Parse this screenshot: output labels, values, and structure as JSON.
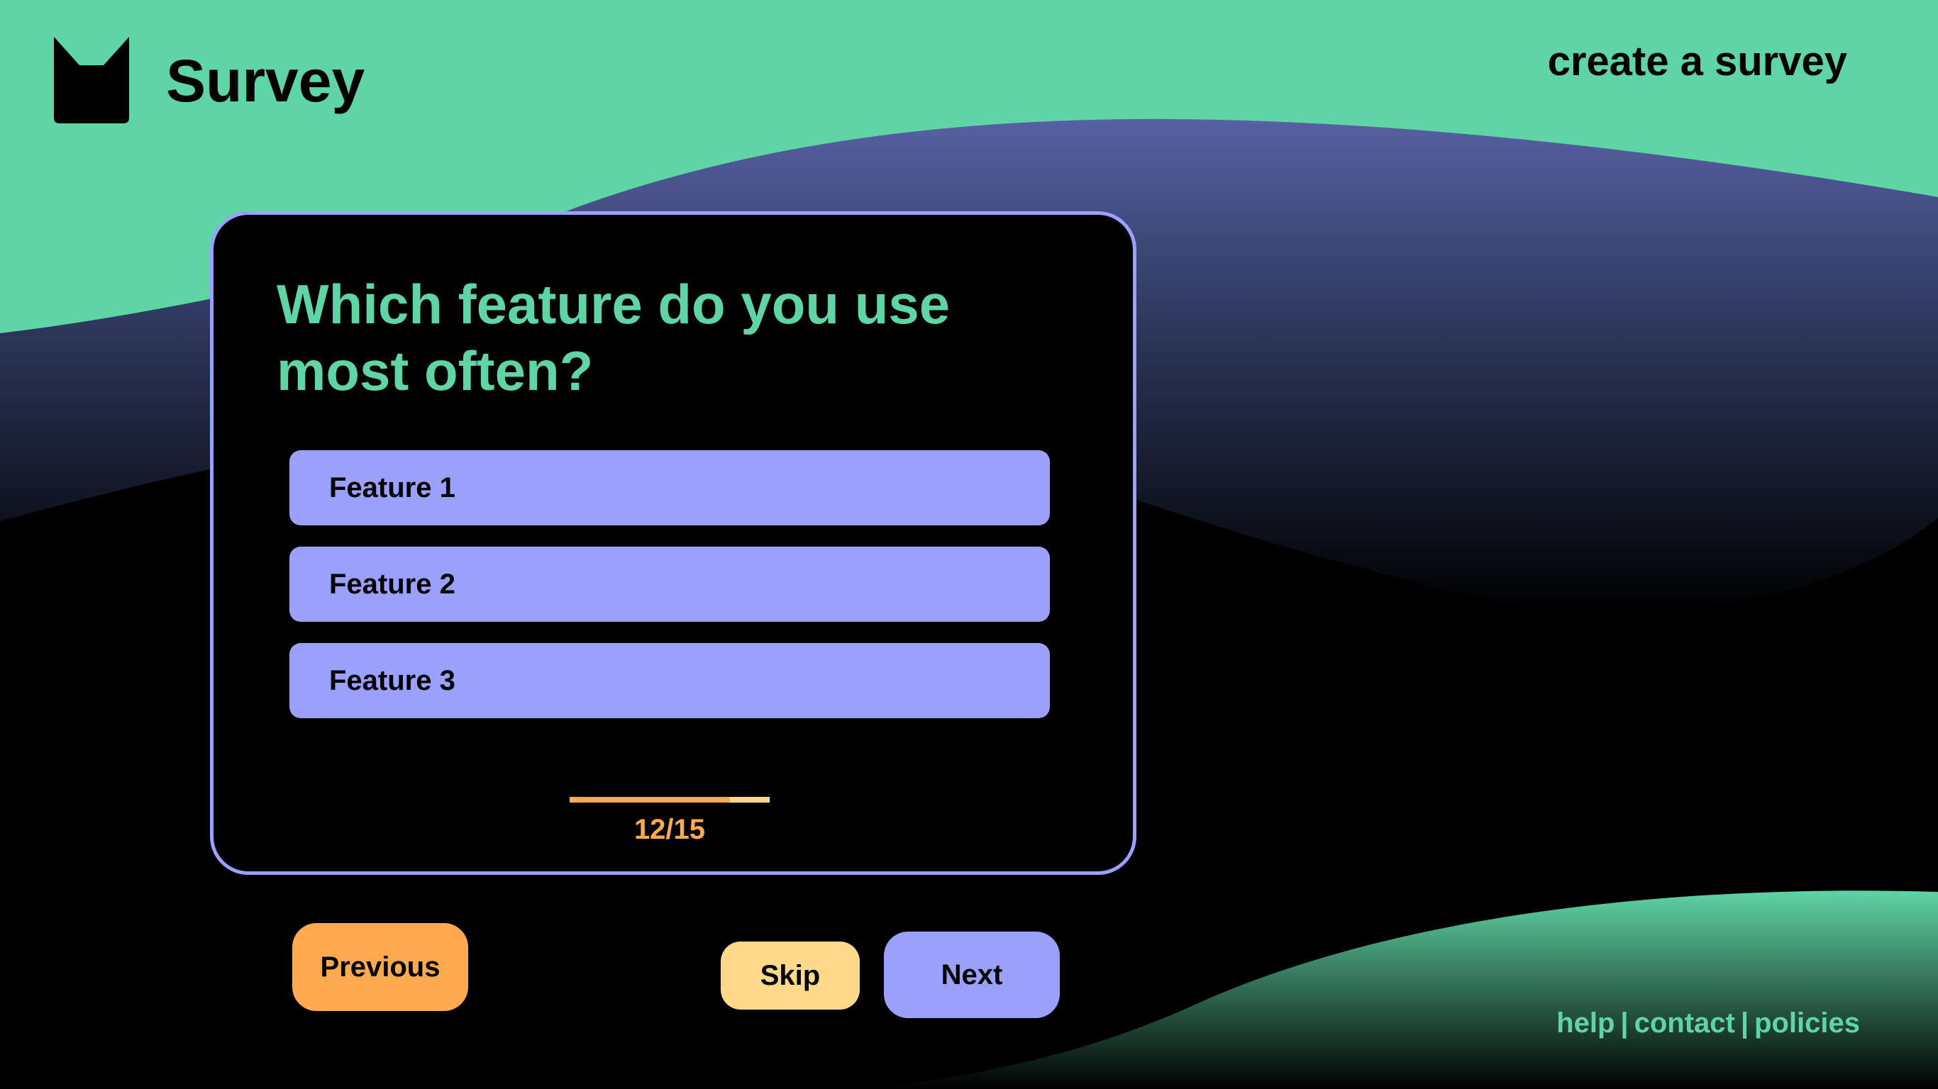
{
  "header": {
    "brand": "Survey",
    "create_link": "create a survey"
  },
  "question": {
    "text": "Which feature do you use most often?",
    "options": [
      {
        "label": "Feature 1"
      },
      {
        "label": "Feature 2"
      },
      {
        "label": "Feature 3"
      }
    ]
  },
  "progress": {
    "current": 12,
    "total": 15,
    "text": "12/15"
  },
  "nav": {
    "previous": "Previous",
    "skip": "Skip",
    "next": "Next"
  },
  "footer": {
    "help": "help",
    "contact": "contact",
    "policies": "policies",
    "separator": "|"
  },
  "colors": {
    "green": "#5fd4a5",
    "purple": "#9aa0fc",
    "orange": "#ffaa4f",
    "light_orange": "#ffd88a",
    "black": "#000000"
  },
  "icons": {
    "logo": "cat-head-icon"
  }
}
